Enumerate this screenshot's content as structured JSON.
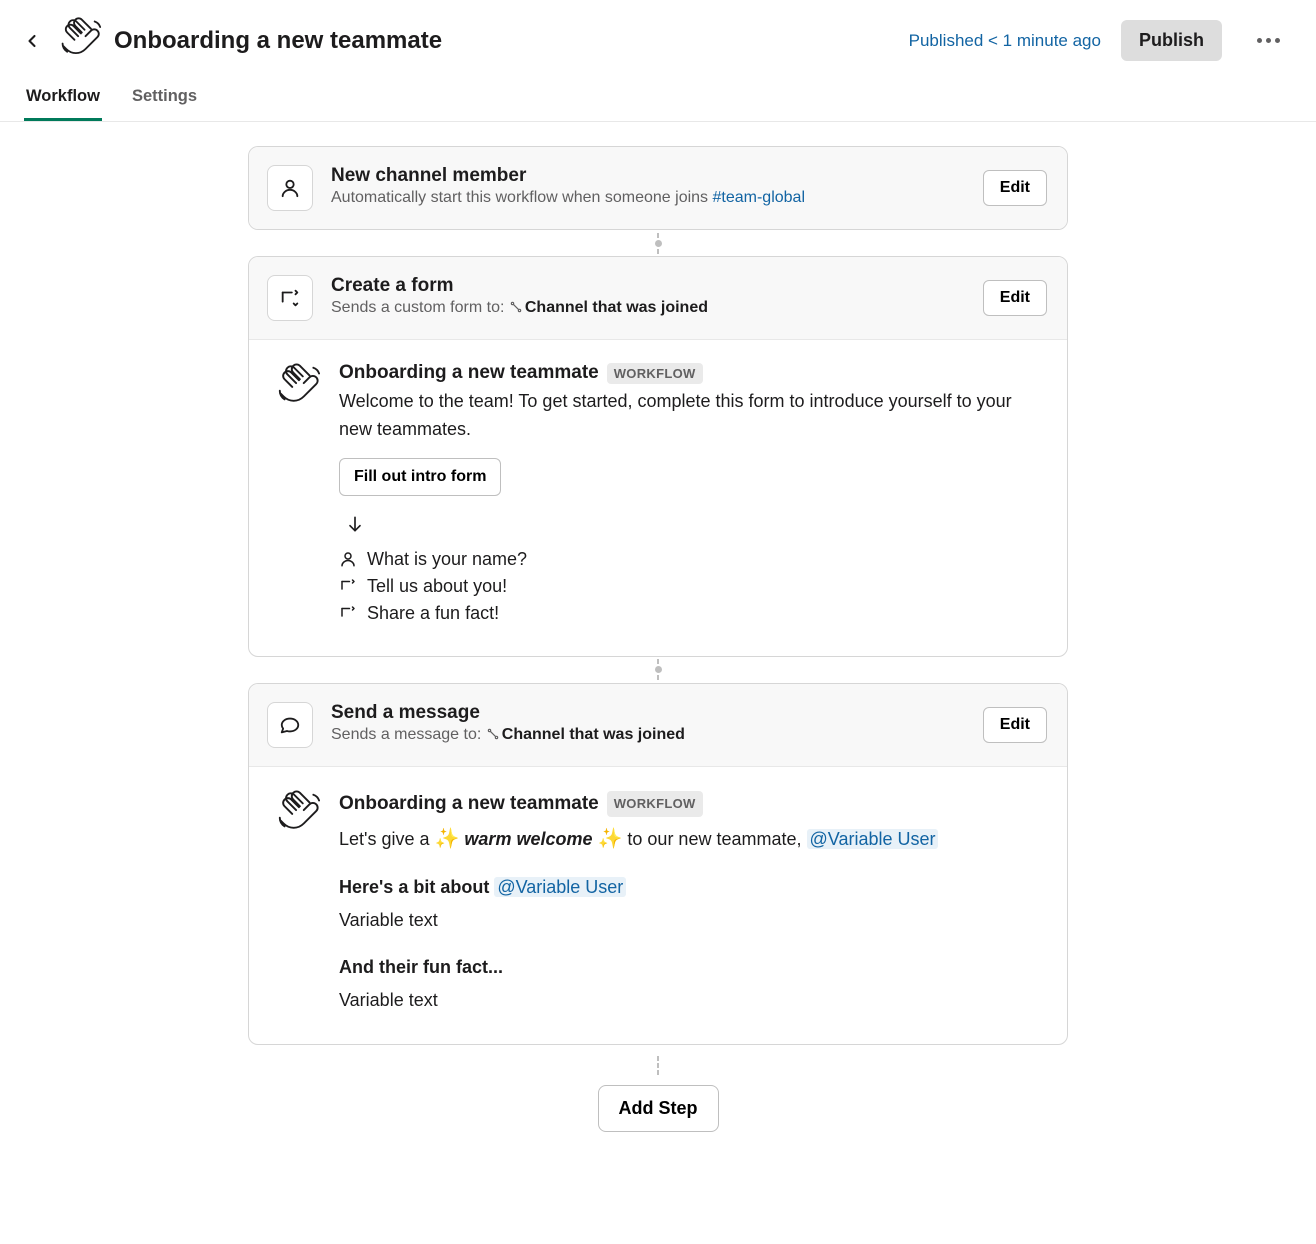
{
  "header": {
    "title": "Onboarding a new teammate",
    "publish_status": "Published < 1 minute ago",
    "publish_btn": "Publish"
  },
  "tabs": {
    "workflow": "Workflow",
    "settings": "Settings"
  },
  "steps": {
    "trigger": {
      "title": "New channel member",
      "desc_prefix": "Automatically start this workflow when someone joins ",
      "channel": "#team-global",
      "edit": "Edit"
    },
    "form": {
      "title": "Create a form",
      "desc_prefix": "Sends a custom form to: ",
      "recipient": "Channel that was joined",
      "edit": "Edit",
      "wf_name": "Onboarding a new teammate",
      "wf_badge": "WORKFLOW",
      "welcome_text": "Welcome to the team! To get started, complete this form to introduce yourself to your new teammates.",
      "fill_btn": "Fill out intro form",
      "questions": [
        "What is your name?",
        "Tell us about you!",
        "Share a fun fact!"
      ]
    },
    "message": {
      "title": "Send a message",
      "desc_prefix": "Sends a message to: ",
      "recipient": "Channel that was joined",
      "edit": "Edit",
      "wf_name": "Onboarding a new teammate",
      "wf_badge": "WORKFLOW",
      "line1_a": "Let's give a ",
      "line1_b": "warm welcome",
      "line1_c": " to our new teammate, ",
      "var_user": "@Variable User",
      "line2_a": "Here's a bit about ",
      "var_text": "Variable text",
      "line3": "And their fun fact..."
    }
  },
  "add_step": "Add Step"
}
